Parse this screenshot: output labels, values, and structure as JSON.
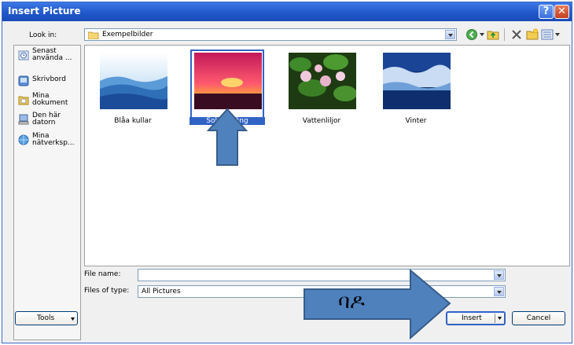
{
  "dialog": {
    "title": "Insert Picture",
    "help_label": "?",
    "close_label": "✕"
  },
  "look_in": {
    "label": "Look in:",
    "value": "Exempelbilder"
  },
  "places": [
    {
      "label": "Senast använda ...",
      "icon": "recent-icon"
    },
    {
      "label": "Skrivbord",
      "icon": "desktop-icon"
    },
    {
      "label": "Mina dokument",
      "icon": "documents-icon"
    },
    {
      "label": "Den här datorn",
      "icon": "computer-icon"
    },
    {
      "label": "Mina nätverksp...",
      "icon": "network-icon"
    }
  ],
  "files": [
    {
      "name": "Blåa kullar",
      "selected": false
    },
    {
      "name": "Solnedgång",
      "selected": true
    },
    {
      "name": "Vattenliljor",
      "selected": false
    },
    {
      "name": "Vinter",
      "selected": false
    }
  ],
  "file_name": {
    "label": "File name:",
    "value": ""
  },
  "files_of_type": {
    "label": "Files of type:",
    "value": "All Pictures"
  },
  "buttons": {
    "tools": "Tools",
    "insert": "Insert",
    "cancel": "Cancel"
  },
  "annotation": {
    "text": "ባዶ",
    "color": "#4f81bd",
    "outline": "#385d8a"
  }
}
